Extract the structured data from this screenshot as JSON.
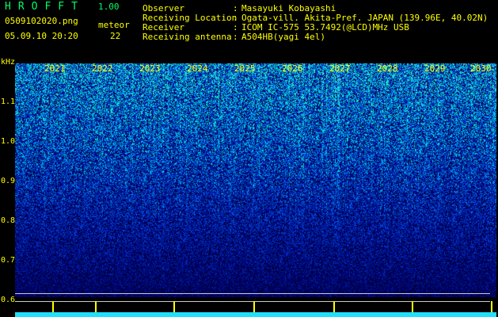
{
  "header": {
    "app_title": "HROFFT",
    "version": "1.00",
    "filename": "0509102020.png",
    "datetime": "05.09.10 20:20",
    "meteor_label": "meteor",
    "meteor_count": "22"
  },
  "info": [
    {
      "label": "Observer",
      "sep": ":",
      "value": "Masayuki Kobayashi"
    },
    {
      "label": "Receiving Location",
      "sep": ":",
      "value": "Ogata-vill. Akita-Pref. JAPAN (139.96E, 40.02N)"
    },
    {
      "label": "Receiver",
      "sep": ":",
      "value": "ICOM IC-575 53.7492(@LCD)MHz USB"
    },
    {
      "label": "Receiving antenna",
      "sep": ":",
      "value": "A504HB(yagi 4el)"
    }
  ],
  "axis": {
    "unit": "kHz",
    "freq_ticks": [
      "1.1",
      "1.0",
      "0.9",
      "0.8",
      "0.7",
      "0.6"
    ],
    "time_ticks": [
      "2021",
      "2022",
      "2023",
      "2024",
      "2025",
      "2026",
      "2027",
      "2028",
      "2029",
      "2030"
    ]
  },
  "colors": {
    "text": "#ffff00",
    "title": "#00ff66",
    "spectrogram_low": "#000064",
    "spectrogram_high": "#00ffcc"
  }
}
